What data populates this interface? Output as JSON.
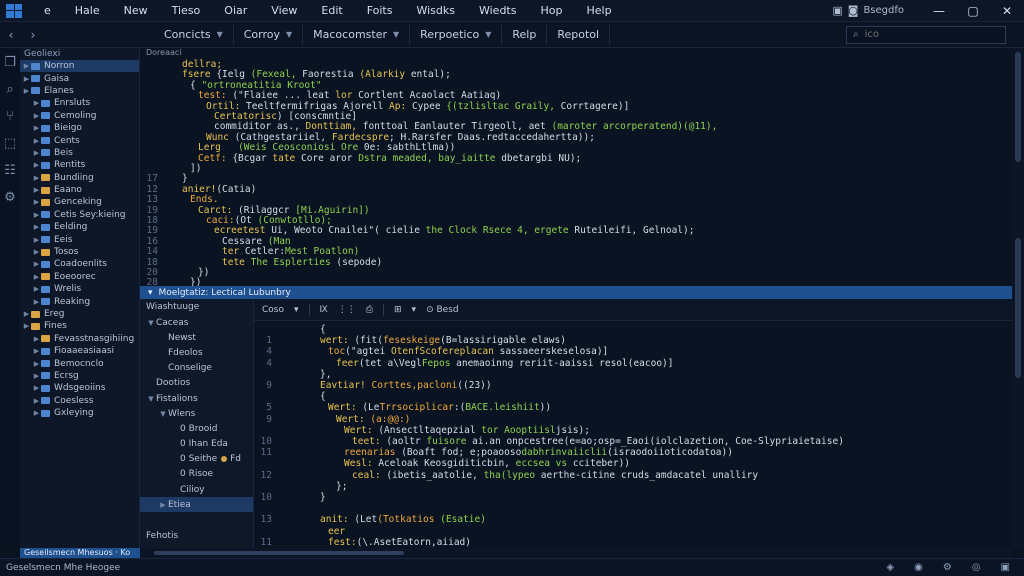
{
  "menubar": {
    "items": [
      "e",
      "Hale",
      "New",
      "Tieso",
      "Oiar",
      "View",
      "Edit",
      "Foits",
      "Wisdks",
      "Wiedts",
      "Hop",
      "Help"
    ],
    "tray_text": "Bsegdfo",
    "minimize": "—",
    "maximize": "▢",
    "close": "✕"
  },
  "toolbar": {
    "tabs": [
      "Concicts",
      "Corroy",
      "Macocomster",
      "Rerpoetico",
      "Relp",
      "Repotol"
    ],
    "search_placeholder": "ico"
  },
  "explorer": {
    "title": "Geoliexi",
    "items": [
      {
        "label": "Norron",
        "kind": "blue",
        "depth": 1,
        "selected": true
      },
      {
        "label": "Gaisa",
        "kind": "blue",
        "depth": 1
      },
      {
        "label": "Elanes",
        "kind": "blue",
        "depth": 1
      },
      {
        "label": "Enrsluts",
        "kind": "blue",
        "depth": 2
      },
      {
        "label": "Cemoling",
        "kind": "blue",
        "depth": 2
      },
      {
        "label": "Bieigo",
        "kind": "blue",
        "depth": 2
      },
      {
        "label": "Cents",
        "kind": "blue",
        "depth": 2
      },
      {
        "label": "Beis",
        "kind": "blue",
        "depth": 2
      },
      {
        "label": "Rentits",
        "kind": "blue",
        "depth": 2
      },
      {
        "label": "Bundiing",
        "kind": "yellow",
        "depth": 2
      },
      {
        "label": "Eaano",
        "kind": "yellow",
        "depth": 2
      },
      {
        "label": "Genceking",
        "kind": "yellow",
        "depth": 2
      },
      {
        "label": "Cetis Sey:kieing",
        "kind": "blue",
        "depth": 2
      },
      {
        "label": "Eelding",
        "kind": "blue",
        "depth": 2
      },
      {
        "label": "Eeis",
        "kind": "blue",
        "depth": 2
      },
      {
        "label": "Tosos",
        "kind": "yellow",
        "depth": 2
      },
      {
        "label": "Coadoenlits",
        "kind": "blue",
        "depth": 2
      },
      {
        "label": "Eoeoorec",
        "kind": "yellow",
        "depth": 2
      },
      {
        "label": "Wrelis",
        "kind": "blue",
        "depth": 2
      },
      {
        "label": "Reaking",
        "kind": "blue",
        "depth": 2
      },
      {
        "label": "Ereg",
        "kind": "yellow",
        "depth": 1
      },
      {
        "label": "Fines",
        "kind": "yellow",
        "depth": 1
      },
      {
        "label": "Fevasstnasgihiing",
        "kind": "yellow",
        "depth": 2
      },
      {
        "label": "Fioaaeasiaasi",
        "kind": "blue",
        "depth": 2
      },
      {
        "label": "Bemocnclo",
        "kind": "blue",
        "depth": 2
      },
      {
        "label": "Ecrsg",
        "kind": "blue",
        "depth": 2
      },
      {
        "label": "Wdsgeoiins",
        "kind": "blue",
        "depth": 2
      },
      {
        "label": "Coesless",
        "kind": "blue",
        "depth": 2
      },
      {
        "label": "Gxleying",
        "kind": "blue",
        "depth": 2
      }
    ],
    "footer_badge": "Geseilsmecn Mhesuos · Ko"
  },
  "editor_top": {
    "crumb": "Doreaaci",
    "lines": [
      {
        "n": "",
        "indent": 2,
        "segs": [
          [
            "kw",
            "dellra;"
          ]
        ]
      },
      {
        "n": "",
        "indent": 2,
        "segs": [
          [
            "kw",
            "fsere"
          ],
          [
            "pl",
            " {Ielg "
          ],
          [
            "str",
            "(Fexeal,"
          ],
          [
            "pl",
            " Faorestia "
          ],
          [
            "kw",
            "(Alarkiy"
          ],
          [
            "pl",
            " ental);"
          ]
        ]
      },
      {
        "n": "",
        "indent": 3,
        "segs": [
          [
            "pl",
            "{ "
          ],
          [
            "str",
            "\"ortroneatitia Kroot\""
          ]
        ]
      },
      {
        "n": "",
        "indent": 4,
        "segs": [
          [
            "fn",
            "test:"
          ],
          [
            "pl",
            " (\"Flaiee ... leat "
          ],
          [
            "kw",
            "lor"
          ],
          [
            "pl",
            " Cortlent Acaolact Aatiaq)"
          ]
        ]
      },
      {
        "n": "",
        "indent": 5,
        "segs": [
          [
            "kw",
            "Ortil:"
          ],
          [
            "pl",
            " Teeltfermifrigas Ajorell "
          ],
          [
            "kw",
            "Ap:"
          ],
          [
            "pl",
            " Cypee "
          ],
          [
            "str",
            "{(tzlisltac Graily,"
          ],
          [
            "pl",
            " Corrtagere)]"
          ]
        ]
      },
      {
        "n": "",
        "indent": 6,
        "segs": [
          [
            "kw",
            "Certatorisc"
          ],
          [
            "pl",
            ") [conscmntie]"
          ]
        ]
      },
      {
        "n": "",
        "indent": 6,
        "segs": [
          [
            "pl",
            "commiditor as., "
          ],
          [
            "kw",
            "Donttiam,"
          ],
          [
            "pl",
            " fonttoal Eanlauter Tirgeoll, aet "
          ],
          [
            "str",
            "(maroter arcorperatend)(@11),"
          ]
        ]
      },
      {
        "n": "",
        "indent": 5,
        "segs": [
          [
            "kw",
            "Wunc"
          ],
          [
            "pl",
            " (Cathgestariiel, "
          ],
          [
            "kw",
            "Fardecspre"
          ],
          [
            "pl",
            "; H.Rarsfer Daas.redtaccedahertta));"
          ]
        ]
      },
      {
        "n": "",
        "indent": 4,
        "segs": [
          [
            "kw",
            "Lerg"
          ],
          [
            "pl",
            "   "
          ],
          [
            "str",
            "(Weis Ceosconiosi Ore"
          ],
          [
            "pl",
            " 0e: sabthLtlma))"
          ]
        ]
      },
      {
        "n": "",
        "indent": 4,
        "segs": [
          [
            "fn",
            "Cetf:"
          ],
          [
            "pl",
            " {Bcgar "
          ],
          [
            "kw",
            "tate"
          ],
          [
            "pl",
            " Core aror "
          ],
          [
            "str",
            "Dstra meaded, bay_iaitte"
          ],
          [
            "pl",
            " dbetargbi NU);"
          ]
        ]
      },
      {
        "n": "",
        "indent": 3,
        "segs": [
          [
            "pl",
            "])"
          ]
        ]
      },
      {
        "n": "17",
        "indent": 2,
        "segs": [
          [
            "pl",
            "}"
          ]
        ]
      },
      {
        "n": "12",
        "indent": 2,
        "segs": [
          [
            "kw",
            "anier!"
          ],
          [
            "pl",
            "(Catia)"
          ]
        ]
      },
      {
        "n": "13",
        "indent": 3,
        "segs": [
          [
            "fn",
            "Ends."
          ]
        ]
      },
      {
        "n": "19",
        "indent": 4,
        "segs": [
          [
            "kw",
            "Carct:"
          ],
          [
            "pl",
            " (Rilaggcr "
          ],
          [
            "str",
            "[Mi.Aguirin])"
          ]
        ]
      },
      {
        "n": "18",
        "indent": 5,
        "segs": [
          [
            "fn",
            "caci:"
          ],
          [
            "pl",
            "(Ot "
          ],
          [
            "str",
            "(Conwtotllo);"
          ]
        ]
      },
      {
        "n": "19",
        "indent": 6,
        "segs": [
          [
            "kw",
            "ecreetest"
          ],
          [
            "pl",
            " Ui, Weoto Cnailei\"( cielie "
          ],
          [
            "str",
            "the Clock Rsece 4, ergete"
          ],
          [
            "pl",
            " Ruteileifi, Gelnoal);"
          ]
        ]
      },
      {
        "n": "16",
        "indent": 7,
        "segs": [
          [
            "pl",
            "Cessare "
          ],
          [
            "str",
            "(Man"
          ]
        ]
      },
      {
        "n": "14",
        "indent": 7,
        "segs": [
          [
            "kw",
            "ter"
          ],
          [
            "pl",
            " Cetler:"
          ],
          [
            "str",
            "Mest Poatlon)"
          ]
        ]
      },
      {
        "n": "18",
        "indent": 7,
        "segs": [
          [
            "kw",
            "tete"
          ],
          [
            "pl",
            " "
          ],
          [
            "str",
            "The Esplerties"
          ],
          [
            "pl",
            " (sepode)"
          ]
        ]
      },
      {
        "n": "20",
        "indent": 4,
        "segs": [
          [
            "pl",
            "})"
          ]
        ]
      },
      {
        "n": "28",
        "indent": 3,
        "segs": [
          [
            "pl",
            "})"
          ]
        ]
      }
    ]
  },
  "split_bar": {
    "text": "Moelgtatiz: Lectical Lubunbry"
  },
  "outline": {
    "title": "Wiashtuuge",
    "items": [
      {
        "label": "Caceas",
        "depth": 1,
        "chev": "▼"
      },
      {
        "label": "Newst",
        "depth": 2
      },
      {
        "label": "Fdeolos",
        "depth": 2
      },
      {
        "label": "Conselige",
        "depth": 2
      },
      {
        "label": "Dootios",
        "depth": 1
      },
      {
        "label": "Fistalions",
        "depth": 1,
        "chev": "▼",
        "dot": false
      },
      {
        "label": "Wlens",
        "depth": 2,
        "chev": "▼"
      },
      {
        "label": "0 Brooid",
        "depth": 3
      },
      {
        "label": "0 Ihan Eda",
        "depth": 3
      },
      {
        "label": "0 Seithe",
        "depth": 3,
        "dot": true,
        "suffix": "Fd"
      },
      {
        "label": "0 Risoe",
        "depth": 3
      },
      {
        "label": "Cilioy",
        "depth": 3
      },
      {
        "label": "Etiea",
        "depth": 2,
        "chev": "▶",
        "selected": true
      }
    ],
    "footer": "Fehotis"
  },
  "editor_bottom": {
    "toolbar": [
      "Coso",
      "▾",
      "Ⅸ",
      "⋮⋮",
      "⎙",
      "⊞",
      "▾",
      "⊙ Besd"
    ],
    "lines": [
      {
        "n": "",
        "indent": 5,
        "segs": [
          [
            "pl",
            "{"
          ]
        ]
      },
      {
        "n": "1",
        "indent": 5,
        "segs": [
          [
            "kw",
            "wert:"
          ],
          [
            "pl",
            " (fit("
          ],
          [
            "fn",
            "feseskeige"
          ],
          [
            "pl",
            "(B=lassirigable elaws)"
          ]
        ]
      },
      {
        "n": "4",
        "indent": 6,
        "segs": [
          [
            "fn",
            "toc"
          ],
          [
            "pl",
            "(\"agtei "
          ],
          [
            "kw",
            "OtenfScofereplacan"
          ],
          [
            "pl",
            " sassaeerskeselosa)]"
          ]
        ]
      },
      {
        "n": "4",
        "indent": 7,
        "segs": [
          [
            "kw",
            "feer"
          ],
          [
            "pl",
            "(tet a\\Vegl"
          ],
          [
            "str",
            "Fepos"
          ],
          [
            "pl",
            " anemaoinng reriit-aaissi resol(eacoo)]"
          ]
        ]
      },
      {
        "n": "",
        "indent": 5,
        "segs": [
          [
            "pl",
            "},"
          ]
        ]
      },
      {
        "n": "9",
        "indent": 5,
        "segs": [
          [
            "kw",
            "Eavtiar!"
          ],
          [
            "pl",
            " "
          ],
          [
            "fn",
            "Corttes,pacloni"
          ],
          [
            "pl",
            "((23))"
          ]
        ]
      },
      {
        "n": "",
        "indent": 5,
        "segs": [
          [
            "pl",
            "{"
          ]
        ]
      },
      {
        "n": "5",
        "indent": 6,
        "segs": [
          [
            "kw",
            "Wert:"
          ],
          [
            "pl",
            " (Le"
          ],
          [
            "fn",
            "Trrsociplicar"
          ],
          [
            "pl",
            ":("
          ],
          [
            "str",
            "BACE.leishiit"
          ],
          [
            "pl",
            "))"
          ]
        ]
      },
      {
        "n": "9",
        "indent": 7,
        "segs": [
          [
            "kw",
            "Wert:"
          ],
          [
            "pl",
            " "
          ],
          [
            "fn",
            "(a:@@:)"
          ]
        ]
      },
      {
        "n": "",
        "indent": 8,
        "segs": [
          [
            "kw",
            "Wert:"
          ],
          [
            "pl",
            " (Ansectltaqepzial "
          ],
          [
            "str",
            "tor Aooptiisl"
          ],
          [
            "pl",
            "jsis);"
          ]
        ]
      },
      {
        "n": "10",
        "indent": 9,
        "segs": [
          [
            "kw",
            "teet:"
          ],
          [
            "pl",
            " (aoltr "
          ],
          [
            "str",
            "fuisore"
          ],
          [
            "pl",
            " ai.an onpcestree(e=ao;osp=_Eaoi(iolclazetion, Coe-Slypriaietaise)"
          ]
        ]
      },
      {
        "n": "11",
        "indent": 8,
        "segs": [
          [
            "fn",
            "reenarias"
          ],
          [
            "pl",
            " (Boaft fod; e;poaooso"
          ],
          [
            "str",
            "dabhrinvaiiclii"
          ],
          [
            "pl",
            "(israodoiioticodatoa))"
          ]
        ]
      },
      {
        "n": "",
        "indent": 8,
        "segs": [
          [
            "kw",
            "Wesl:"
          ],
          [
            "pl",
            " Aceloak Keosgiditicbin, "
          ],
          [
            "str",
            "eccsea vs"
          ],
          [
            "pl",
            " cciteber))"
          ]
        ]
      },
      {
        "n": "12",
        "indent": 9,
        "segs": [
          [
            "kw",
            "ceal:"
          ],
          [
            "pl",
            " (ibetis_aatolie, "
          ],
          [
            "str",
            "tha(lypeo"
          ],
          [
            "pl",
            " aerthe-citine cruds_amdacatel unalliry"
          ]
        ]
      },
      {
        "n": "",
        "indent": 7,
        "segs": [
          [
            "pl",
            "};"
          ]
        ]
      },
      {
        "n": "10",
        "indent": 5,
        "segs": [
          [
            "pl",
            "}"
          ]
        ]
      },
      {
        "n": "",
        "indent": 5,
        "segs": [
          [
            "pl",
            ""
          ]
        ]
      },
      {
        "n": "13",
        "indent": 5,
        "segs": [
          [
            "kw",
            "anit:"
          ],
          [
            "pl",
            " (Let"
          ],
          [
            "fn",
            "(Totkatios"
          ],
          [
            "pl",
            " "
          ],
          [
            "str",
            "(Esatie)"
          ]
        ]
      },
      {
        "n": "",
        "indent": 6,
        "segs": [
          [
            "kw",
            "eer"
          ]
        ]
      },
      {
        "n": "11",
        "indent": 6,
        "segs": [
          [
            "kw",
            "fest:"
          ],
          [
            "pl",
            "(\\.AsetEatorn,aiiad)"
          ]
        ]
      }
    ]
  },
  "statusbar": {
    "left": "Geselsmecn Mhe Heogee",
    "right": [
      "◈",
      "◉",
      "⚙",
      "◎",
      "▣"
    ]
  }
}
